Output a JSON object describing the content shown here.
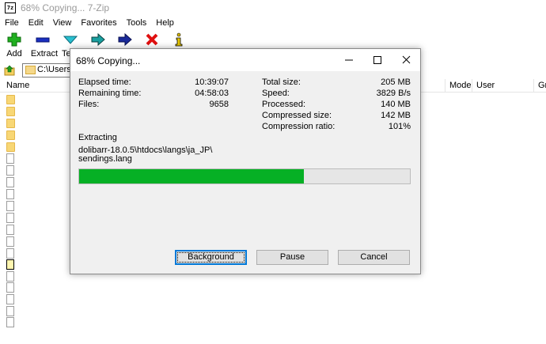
{
  "app": {
    "title": "68% Copying... 7-Zip",
    "icon_label": "7z",
    "menu": [
      "File",
      "Edit",
      "View",
      "Favorites",
      "Tools",
      "Help"
    ],
    "toolbar": [
      {
        "label": "Add",
        "icon": "add-icon"
      },
      {
        "label": "Extract",
        "icon": "extract-icon"
      },
      {
        "label": "Te",
        "icon": "test-icon"
      },
      {
        "label": "",
        "icon": "copy-icon"
      },
      {
        "label": "",
        "icon": "move-icon"
      },
      {
        "label": "",
        "icon": "delete-icon"
      },
      {
        "label": "",
        "icon": "info-icon"
      }
    ],
    "path": "C:\\Users\\S",
    "columns": {
      "name": "Name",
      "mode": "Mode",
      "user": "User",
      "group": "Gr"
    }
  },
  "dialog": {
    "title": "68% Copying...",
    "stats_left": [
      {
        "label": "Elapsed time:",
        "value": "10:39:07"
      },
      {
        "label": "Remaining time:",
        "value": "04:58:03"
      },
      {
        "label": "Files:",
        "value": "9658"
      }
    ],
    "stats_right": [
      {
        "label": "Total size:",
        "value": "205 MB"
      },
      {
        "label": "Speed:",
        "value": "3829 B/s"
      },
      {
        "label": "Processed:",
        "value": "140 MB"
      },
      {
        "label": "Compressed size:",
        "value": "142 MB"
      },
      {
        "label": "Compression ratio:",
        "value": "101%"
      }
    ],
    "operation": "Extracting",
    "current_file_line1": "dolibarr-18.0.5\\htdocs\\langs\\ja_JP\\",
    "current_file_line2": "sendings.lang",
    "progress": 0.68,
    "buttons": {
      "background": "Background",
      "pause": "Pause",
      "cancel": "Cancel"
    },
    "colors": {
      "progress": "#06b025"
    }
  }
}
